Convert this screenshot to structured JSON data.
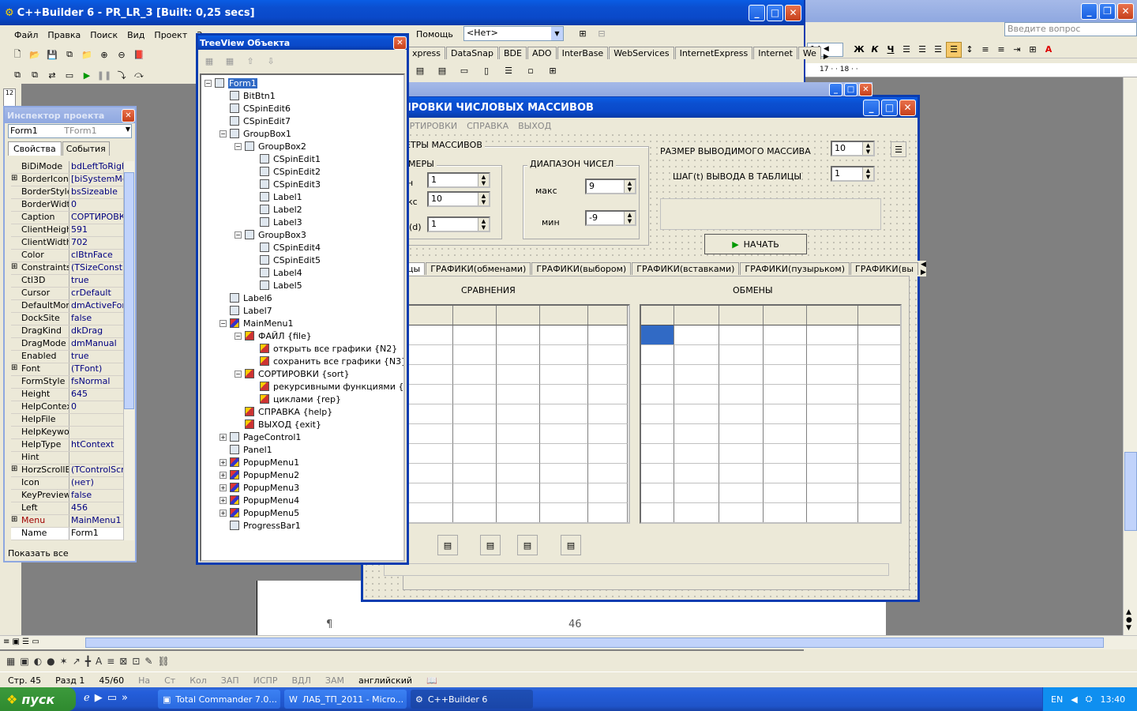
{
  "ide": {
    "title": "C++Builder 6 - PR_LR_3 [Built: 0,25 secs]",
    "menu": [
      "Файл",
      "Правка",
      "Поиск",
      "Вид",
      "Проект",
      "Запу"
    ],
    "menu_help": "Помощь",
    "combo_value": "<Нет>",
    "palette_tabs": [
      "xpress",
      "DataSnap",
      "BDE",
      "ADO",
      "InterBase",
      "WebServices",
      "InternetExpress",
      "Internet",
      "We"
    ]
  },
  "word": {
    "ask_placeholder": "Введите вопрос",
    "font_size": "14",
    "ruler": "17 · · 18 · ·",
    "page_number": "46",
    "pilcrow": "¶",
    "status": [
      "Стр. 45",
      "Разд 1",
      "45/60",
      "На",
      "Ст",
      "Кол",
      "ЗАП",
      "ИСПР",
      "ВДЛ",
      "ЗАМ",
      "английский"
    ]
  },
  "inspector": {
    "title": "Инспектор проекта",
    "object": "Form1",
    "object_type": "TForm1",
    "tabs": [
      "Свойства",
      "События"
    ],
    "rows": [
      {
        "k": "BiDiMode",
        "v": "bdLeftToRight",
        "plus": false
      },
      {
        "k": "BorderIcons",
        "v": "[biSystemMenu",
        "plus": true
      },
      {
        "k": "BorderStyle",
        "v": "bsSizeable",
        "plus": false
      },
      {
        "k": "BorderWidth",
        "v": "0",
        "plus": false
      },
      {
        "k": "Caption",
        "v": "СОРТИРОВКИ",
        "plus": false
      },
      {
        "k": "ClientHeight",
        "v": "591",
        "plus": false
      },
      {
        "k": "ClientWidth",
        "v": "702",
        "plus": false
      },
      {
        "k": "Color",
        "v": "clBtnFace",
        "plus": false
      },
      {
        "k": "Constraints",
        "v": "(TSizeConstrai",
        "plus": true
      },
      {
        "k": "Ctl3D",
        "v": "true",
        "plus": false
      },
      {
        "k": "Cursor",
        "v": "crDefault",
        "plus": false
      },
      {
        "k": "DefaultMoni",
        "v": "dmActiveForm",
        "plus": false
      },
      {
        "k": "DockSite",
        "v": "false",
        "plus": false
      },
      {
        "k": "DragKind",
        "v": "dkDrag",
        "plus": false
      },
      {
        "k": "DragMode",
        "v": "dmManual",
        "plus": false
      },
      {
        "k": "Enabled",
        "v": "true",
        "plus": false
      },
      {
        "k": "Font",
        "v": "(TFont)",
        "plus": true
      },
      {
        "k": "FormStyle",
        "v": "fsNormal",
        "plus": false
      },
      {
        "k": "Height",
        "v": "645",
        "plus": false
      },
      {
        "k": "HelpContext",
        "v": "0",
        "plus": false
      },
      {
        "k": "HelpFile",
        "v": "",
        "plus": false
      },
      {
        "k": "HelpKeywor",
        "v": "",
        "plus": false
      },
      {
        "k": "HelpType",
        "v": "htContext",
        "plus": false
      },
      {
        "k": "Hint",
        "v": "",
        "plus": false
      },
      {
        "k": "HorzScrollB",
        "v": "(TControlScroll",
        "plus": true
      },
      {
        "k": "Icon",
        "v": "(нет)",
        "plus": false
      },
      {
        "k": "KeyPreview",
        "v": "false",
        "plus": false
      },
      {
        "k": "Left",
        "v": "456",
        "plus": false
      },
      {
        "k": "Menu",
        "v": "MainMenu1",
        "plus": true
      },
      {
        "k": "Name",
        "v": "Form1",
        "plus": false
      }
    ],
    "footer": "Показать все"
  },
  "tree": {
    "title": "TreeView Объекта",
    "items": [
      {
        "t": "Form1",
        "lvl": 0,
        "pm": "−",
        "ico": "form"
      },
      {
        "t": "BitBtn1",
        "lvl": 1,
        "pm": "",
        "ico": "comp"
      },
      {
        "t": "CSpinEdit6",
        "lvl": 1,
        "pm": "",
        "ico": "comp"
      },
      {
        "t": "CSpinEdit7",
        "lvl": 1,
        "pm": "",
        "ico": "comp"
      },
      {
        "t": "GroupBox1",
        "lvl": 1,
        "pm": "−",
        "ico": "comp"
      },
      {
        "t": "GroupBox2",
        "lvl": 2,
        "pm": "−",
        "ico": "comp"
      },
      {
        "t": "CSpinEdit1",
        "lvl": 3,
        "pm": "",
        "ico": "comp"
      },
      {
        "t": "CSpinEdit2",
        "lvl": 3,
        "pm": "",
        "ico": "comp"
      },
      {
        "t": "CSpinEdit3",
        "lvl": 3,
        "pm": "",
        "ico": "comp"
      },
      {
        "t": "Label1",
        "lvl": 3,
        "pm": "",
        "ico": "comp"
      },
      {
        "t": "Label2",
        "lvl": 3,
        "pm": "",
        "ico": "comp"
      },
      {
        "t": "Label3",
        "lvl": 3,
        "pm": "",
        "ico": "comp"
      },
      {
        "t": "GroupBox3",
        "lvl": 2,
        "pm": "−",
        "ico": "comp"
      },
      {
        "t": "CSpinEdit4",
        "lvl": 3,
        "pm": "",
        "ico": "comp"
      },
      {
        "t": "CSpinEdit5",
        "lvl": 3,
        "pm": "",
        "ico": "comp"
      },
      {
        "t": "Label4",
        "lvl": 3,
        "pm": "",
        "ico": "comp"
      },
      {
        "t": "Label5",
        "lvl": 3,
        "pm": "",
        "ico": "comp"
      },
      {
        "t": "Label6",
        "lvl": 1,
        "pm": "",
        "ico": "comp"
      },
      {
        "t": "Label7",
        "lvl": 1,
        "pm": "",
        "ico": "comp"
      },
      {
        "t": "MainMenu1",
        "lvl": 1,
        "pm": "−",
        "ico": "menu"
      },
      {
        "t": "ФАЙЛ {file}",
        "lvl": 2,
        "pm": "−",
        "ico": "item"
      },
      {
        "t": "открыть все графики {N2}",
        "lvl": 3,
        "pm": "",
        "ico": "item"
      },
      {
        "t": "сохранить все графики {N3}",
        "lvl": 3,
        "pm": "",
        "ico": "item"
      },
      {
        "t": "СОРТИРОВКИ {sort}",
        "lvl": 2,
        "pm": "−",
        "ico": "item"
      },
      {
        "t": "рекурсивными функциями {rec}",
        "lvl": 3,
        "pm": "",
        "ico": "item"
      },
      {
        "t": "циклами {rep}",
        "lvl": 3,
        "pm": "",
        "ico": "item"
      },
      {
        "t": "СПРАВКА {help}",
        "lvl": 2,
        "pm": "",
        "ico": "item"
      },
      {
        "t": "ВЫХОД {exit}",
        "lvl": 2,
        "pm": "",
        "ico": "item"
      },
      {
        "t": "PageControl1",
        "lvl": 1,
        "pm": "+",
        "ico": "comp"
      },
      {
        "t": "Panel1",
        "lvl": 1,
        "pm": "",
        "ico": "comp"
      },
      {
        "t": "PopupMenu1",
        "lvl": 1,
        "pm": "+",
        "ico": "menu"
      },
      {
        "t": "PopupMenu2",
        "lvl": 1,
        "pm": "+",
        "ico": "menu"
      },
      {
        "t": "PopupMenu3",
        "lvl": 1,
        "pm": "+",
        "ico": "menu"
      },
      {
        "t": "PopupMenu4",
        "lvl": 1,
        "pm": "+",
        "ico": "menu"
      },
      {
        "t": "PopupMenu5",
        "lvl": 1,
        "pm": "+",
        "ico": "menu"
      },
      {
        "t": "ProgressBar1",
        "lvl": 1,
        "pm": "",
        "ico": "comp"
      }
    ]
  },
  "form": {
    "title": "ИРОВКИ ЧИСЛОВЫХ МАССИВОВ",
    "menu": [
      "ОРТИРОВКИ",
      "СПРАВКА",
      "ВЫХОД"
    ],
    "gb1_label": "ЕТРЫ МАССИВОВ",
    "gb2_label": "МЕРЫ",
    "gb3_label": "ДИАПАЗОН ЧИСЕЛ",
    "lbl_n": "н",
    "lbl_kc": "кс",
    "lbl_d": "(d)",
    "spin1": "1",
    "spin2": "10",
    "spin3": "1",
    "lbl_max": "макс",
    "lbl_min": "мин",
    "spin_max": "9",
    "spin_min": "-9",
    "lbl_size": "РАЗМЕР ВЫВОДИМОГО МАССИВА",
    "lbl_step": "ШАГ(t) ВЫВОДА В ТАБЛИЦЫ",
    "spin_size": "10",
    "spin_step": "1",
    "start_btn": "НАЧАТЬ",
    "tabs": [
      "цы",
      "ГРАФИКИ(обменами)",
      "ГРАФИКИ(выбором)",
      "ГРАФИКИ(вставками)",
      "ГРАФИКИ(пузырьком)",
      "ГРАФИКИ(вы"
    ],
    "lbl_compare": "СРАВНЕНИЯ",
    "lbl_swaps": "ОБМЕНЫ"
  },
  "taskbar": {
    "start": "пуск",
    "tasks": [
      "Total Commander 7.0...",
      "ЛАБ_ТП_2011 - Micro...",
      "C++Builder 6"
    ],
    "lang": "EN",
    "time": "13:40"
  }
}
